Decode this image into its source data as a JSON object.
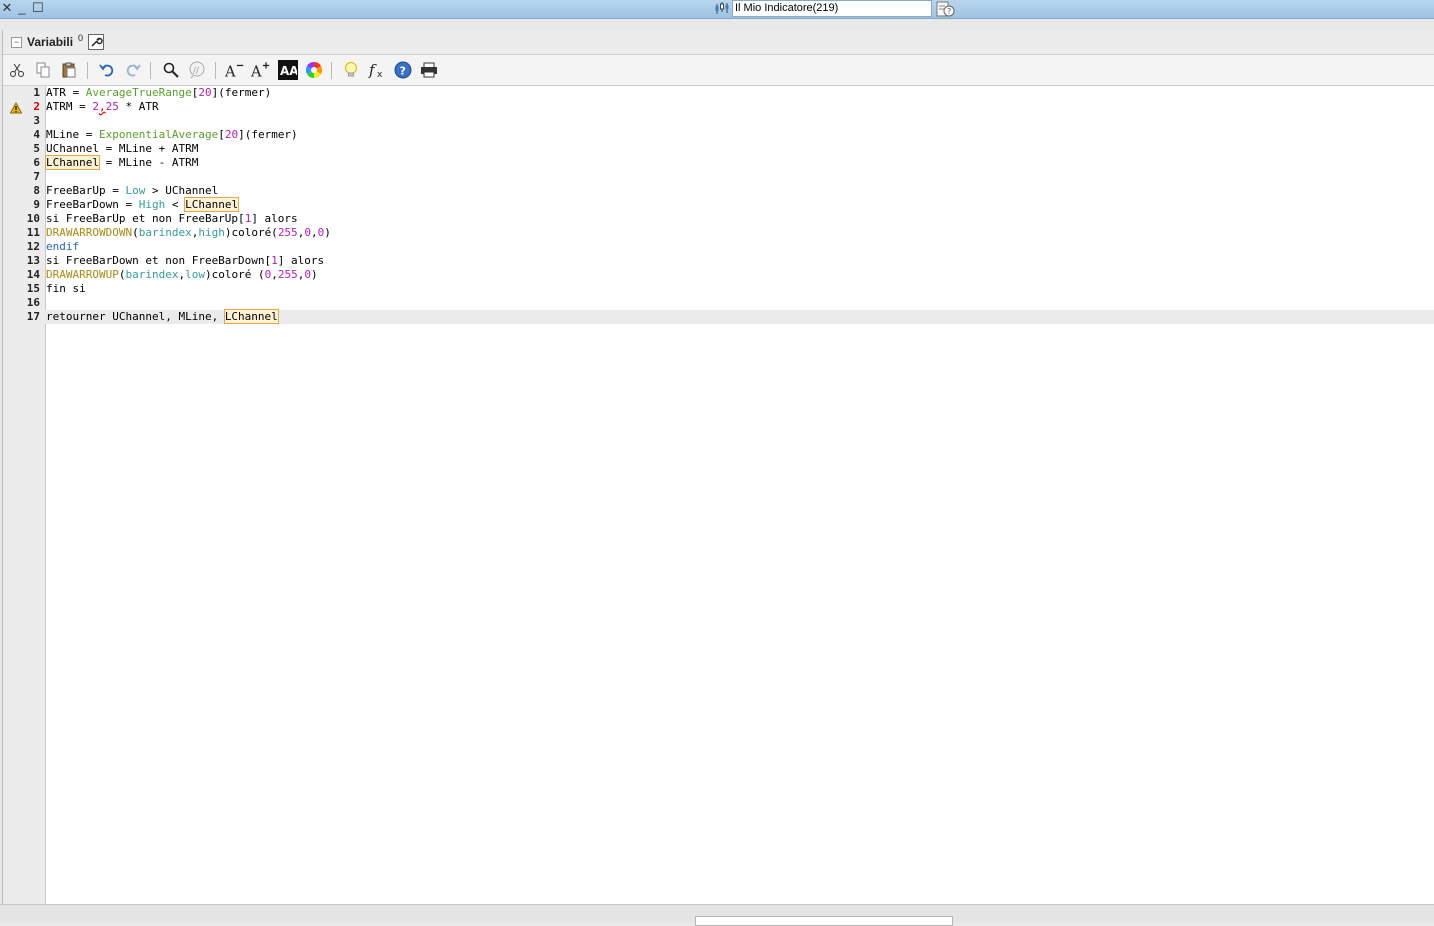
{
  "window": {
    "title_field": "Il Mio Indicatore(219)",
    "controls": {
      "close": "✕",
      "minimize": "_",
      "maximize": "☐"
    }
  },
  "variables_panel": {
    "collapse_glyph": "−",
    "label": "Variabili",
    "count": "0"
  },
  "toolbar": {
    "icons": [
      "scissors-icon",
      "copy-icon",
      "paste-icon",
      "undo-icon",
      "redo-icon",
      "search-icon",
      "comment-icon",
      "decrease-font-icon",
      "increase-font-icon",
      "font-style-icon",
      "color-wheel-icon",
      "lightbulb-icon",
      "function-icon",
      "help-icon",
      "print-icon"
    ]
  },
  "editor": {
    "error_line": "2",
    "current_line": "17",
    "lines": [
      {
        "n": "1"
      },
      {
        "n": "2"
      },
      {
        "n": "3"
      },
      {
        "n": "4"
      },
      {
        "n": "5"
      },
      {
        "n": "6"
      },
      {
        "n": "7"
      },
      {
        "n": "8"
      },
      {
        "n": "9"
      },
      {
        "n": "10"
      },
      {
        "n": "11"
      },
      {
        "n": "12"
      },
      {
        "n": "13"
      },
      {
        "n": "14"
      },
      {
        "n": "15"
      },
      {
        "n": "16"
      },
      {
        "n": "17"
      }
    ],
    "code": {
      "l1": {
        "a": "ATR = ",
        "fn": "AverageTrueRange",
        "b": "[",
        "num": "20",
        "c": "](fermer)"
      },
      "l2": {
        "a": "ATRM = ",
        "num1": "2",
        "b": ",",
        "num2": "25",
        "c": " * ATR"
      },
      "l4": {
        "a": "MLine = ",
        "fn": "ExponentialAverage",
        "b": "[",
        "num": "20",
        "c": "](fermer)"
      },
      "l5": {
        "a": "UChannel = MLine + ATRM"
      },
      "l6": {
        "hl": "LChannel",
        "a": " = MLine - ATRM"
      },
      "l8": {
        "a": "FreeBarUp = ",
        "kw": "Low",
        "b": " > UChannel"
      },
      "l9": {
        "a": "FreeBarDown = ",
        "kw": "High",
        "b": " < ",
        "hl": "LChannel"
      },
      "l10": {
        "a": "si FreeBarUp et non FreeBarUp[",
        "num": "1",
        "b": "] alors"
      },
      "l11": {
        "draw": "DRAWARROWDOWN",
        "a": "(",
        "kw1": "barindex",
        "b": ",",
        "kw2": "high",
        "c": ")coloré(",
        "n1": "255",
        "d": ",",
        "n2": "0",
        "e": ",",
        "n3": "0",
        "f": ")"
      },
      "l12": {
        "kw": "endif"
      },
      "l13": {
        "a": "si FreeBarDown et non FreeBarDown[",
        "num": "1",
        "b": "] alors"
      },
      "l14": {
        "draw": "DRAWARROWUP",
        "a": "(",
        "kw1": "barindex",
        "b": ",",
        "kw2": "low",
        "c": ")coloré (",
        "n1": "0",
        "d": ",",
        "n2": "255",
        "e": ",",
        "n3": "0",
        "f": ")"
      },
      "l15": {
        "a": "fin si"
      },
      "l17": {
        "a": "retourner UChannel, MLine, ",
        "hl": "LChannel"
      }
    }
  },
  "colors": {
    "function": "#5a9e2e",
    "number": "#b222b2",
    "keyword": "#3a9a9a",
    "draw": "#a88a1a",
    "highlight_bg": "#fff3d6",
    "error_line_number": "#d00000"
  }
}
